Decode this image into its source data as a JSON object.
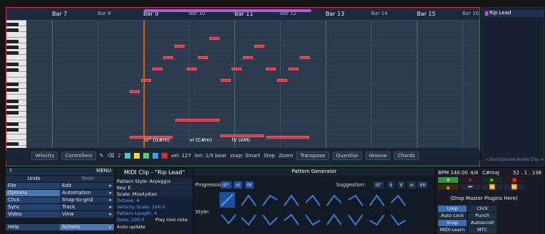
{
  "piano_roll": {
    "bars": [
      {
        "label": "Bar 7",
        "major": true
      },
      {
        "label": "Bar 8",
        "major": false
      },
      {
        "label": "Bar 9",
        "major": true
      },
      {
        "label": "Bar 10",
        "major": false
      },
      {
        "label": "Bar 11",
        "major": true
      },
      {
        "label": "Bar 12",
        "major": false
      },
      {
        "label": "Bar 13",
        "major": true
      },
      {
        "label": "Bar 14",
        "major": false
      },
      {
        "label": "Bar 15",
        "major": true
      },
      {
        "label": "Bar 16",
        "major": false
      }
    ],
    "chords": [
      "iii° (G#m)",
      "vi (C#m)",
      "IV (AM)"
    ],
    "toolbar": {
      "velocity_label": "Velocity",
      "controllers_label": "Controllers",
      "vel_value": "vel: 127",
      "len_value": "len: 1/5 beat",
      "snap_value": "snap: Smart",
      "step_label": "Step",
      "zoom_label": "Zoom",
      "transpose_label": "Transpose",
      "quantise_label": "Quantise",
      "groove_label": "Groove",
      "chords_label": "Chords"
    },
    "colors": {
      "note": "#e82c3c",
      "swatches": [
        "#4fc0e0",
        "#f0e020",
        "#50d060",
        "#3aa0f0",
        "#e02a2a",
        "#a040e0"
      ]
    }
  },
  "track": {
    "name": "Rip Lead",
    "background_clip": "< Background Audio Clip >"
  },
  "left_panel": {
    "menu_label": "MENU",
    "rows": [
      [
        "Undo",
        "Redo"
      ],
      [
        "File",
        "Edit"
      ],
      [
        "Options",
        "Automation"
      ],
      [
        "Click",
        "Snap-to-grid"
      ],
      [
        "Sync",
        "Track"
      ],
      [
        "Video",
        "View"
      ],
      [
        "Help",
        "Actions"
      ]
    ]
  },
  "clip_panel": {
    "title": "MIDI Clip - \"Rip Lead\"",
    "pattern_style": "Pattern Style: Arpeggio",
    "key": "Key: E",
    "scale": "Scale: Mixolydian",
    "octave": "Octave: 4",
    "velocity_scale": "Velocity Scale: 100.0",
    "pattern_length": "Pattern Length: 4",
    "gate": "Gate: 100.0",
    "play_root": "Play root note",
    "auto_update": "Auto update"
  },
  "pattern_generator": {
    "title": "Pattern Generator",
    "progression_label": "Progression:",
    "progression": [
      "iii°",
      "vi",
      "IV"
    ],
    "suggestion_label": "Suggestion:",
    "suggestions": [
      "iii°",
      "ii",
      "V",
      "vi",
      "VII"
    ],
    "style_label": "Style:"
  },
  "transport": {
    "bpm": "BPM 140.00",
    "sig": "4/4",
    "key": "C#maj",
    "position": "52 . 1 . 138",
    "plugins_label": "(Drop Master Plugins Here)",
    "buttons": [
      [
        "Loop",
        "Click"
      ],
      [
        "Auto Lock",
        "Punch"
      ],
      [
        "Snap",
        "Autoscroll"
      ],
      [
        "MIDI Learn",
        "MTC"
      ]
    ]
  }
}
